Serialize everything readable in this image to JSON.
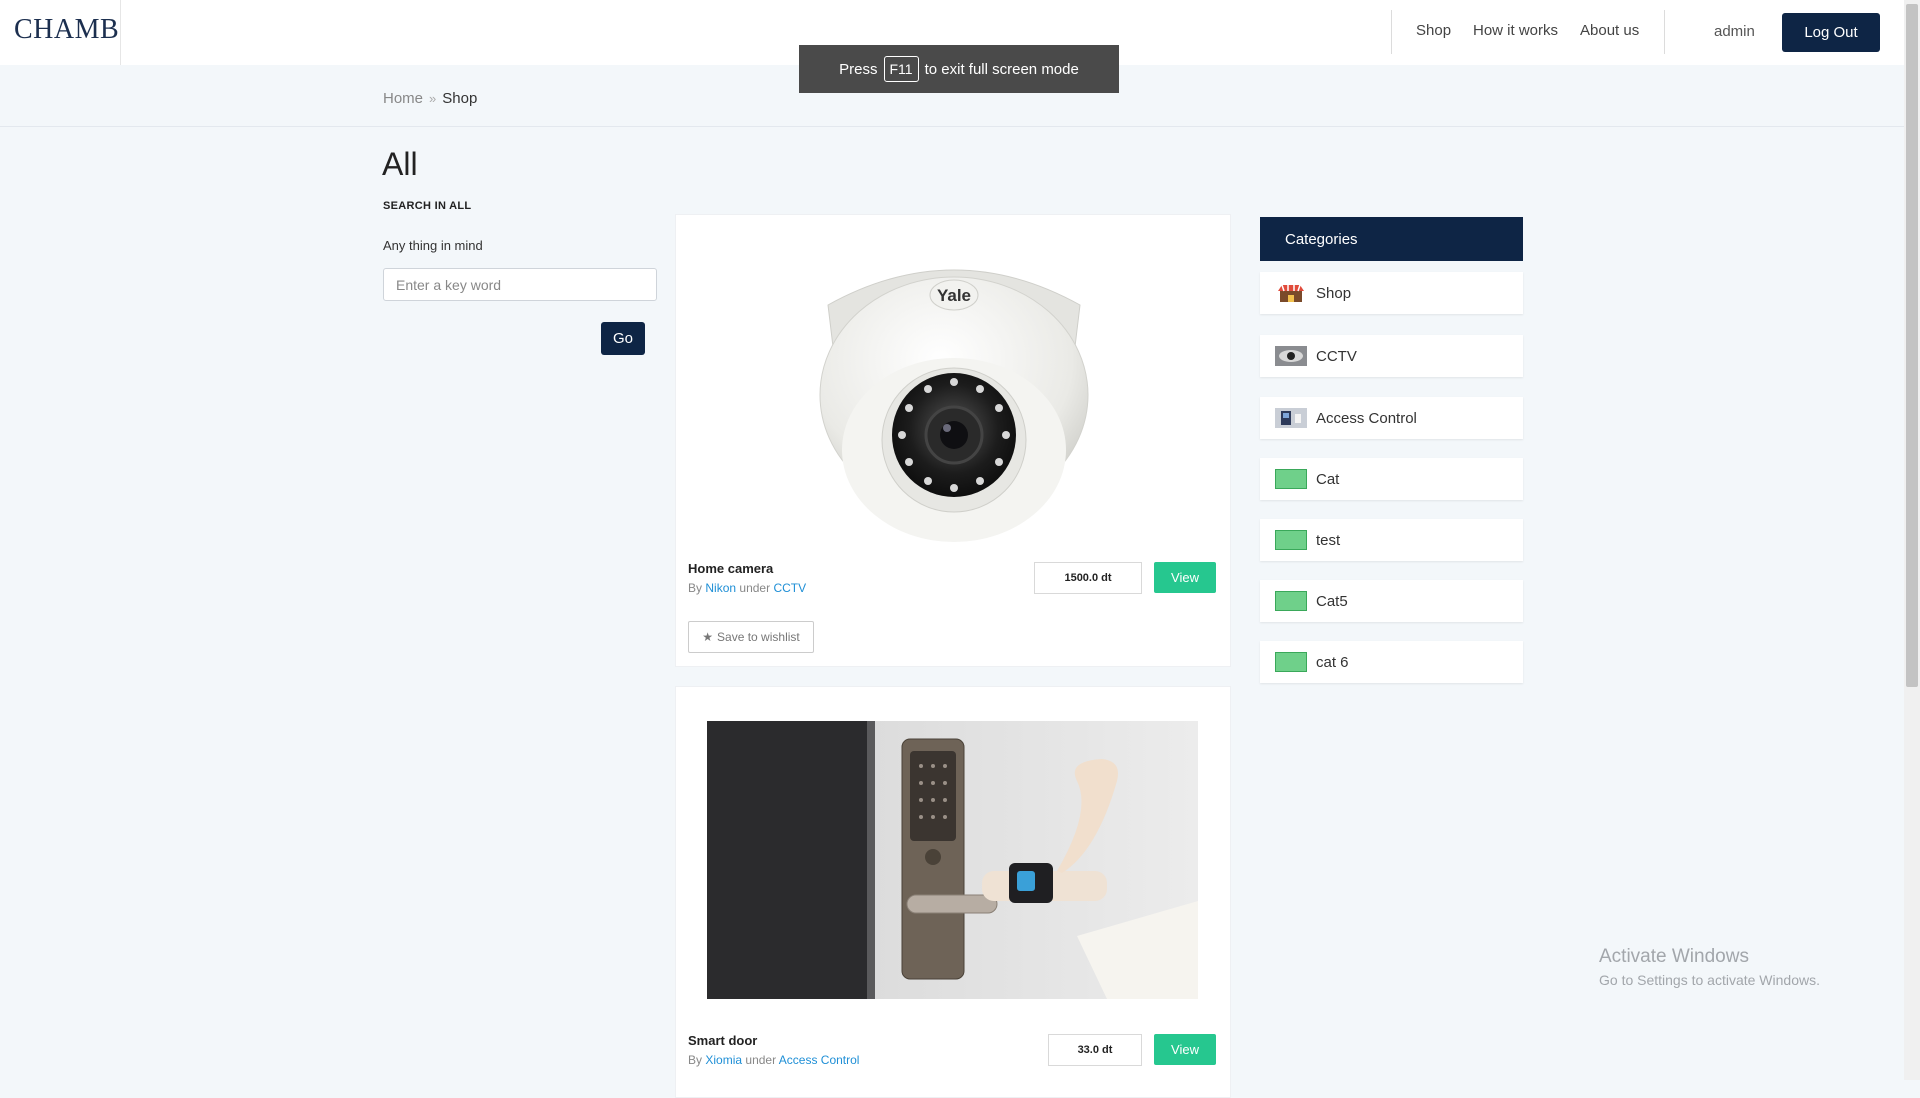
{
  "header": {
    "logo": "CHAMB",
    "nav": [
      "Shop",
      "How it works",
      "About us"
    ],
    "user": "admin",
    "logout_label": "Log Out"
  },
  "toast": {
    "before": "Press",
    "key": "F11",
    "after": "to exit full screen mode"
  },
  "breadcrumb": {
    "home": "Home",
    "separator": "»",
    "current": "Shop"
  },
  "page_title": "All",
  "search": {
    "heading": "SEARCH IN ALL",
    "label": "Any thing in mind",
    "placeholder": "Enter a key word",
    "go_label": "Go"
  },
  "products": [
    {
      "name": "Home camera",
      "by_label": "By",
      "brand": "Nikon",
      "under_label": "under",
      "category": "CCTV",
      "price": "1500.0 dt",
      "view_label": "View",
      "wishlist_label": "Save to wishlist",
      "image_brand": "Yale"
    },
    {
      "name": "Smart door",
      "by_label": "By",
      "brand": "Xiomia",
      "under_label": "under",
      "category": "Access Control",
      "price": "33.0 dt",
      "view_label": "View"
    }
  ],
  "categories": {
    "title": "Categories",
    "items": [
      {
        "label": "Shop",
        "icon": "shop-icon"
      },
      {
        "label": "CCTV",
        "icon": "cctv-thumbnail"
      },
      {
        "label": "Access Control",
        "icon": "access-control-thumbnail"
      },
      {
        "label": "Cat",
        "icon": "green-placeholder-thumbnail"
      },
      {
        "label": "test",
        "icon": "green-placeholder-thumbnail"
      },
      {
        "label": "Cat5",
        "icon": "green-placeholder-thumbnail"
      },
      {
        "label": "cat 6",
        "icon": "green-placeholder-thumbnail"
      }
    ]
  },
  "watermark": {
    "line1": "Activate Windows",
    "line2": "Go to Settings to activate Windows."
  },
  "colors": {
    "primary": "#0e2545",
    "accent": "#26c78f",
    "link": "#1f8fd6",
    "background": "#f3f7fa"
  }
}
